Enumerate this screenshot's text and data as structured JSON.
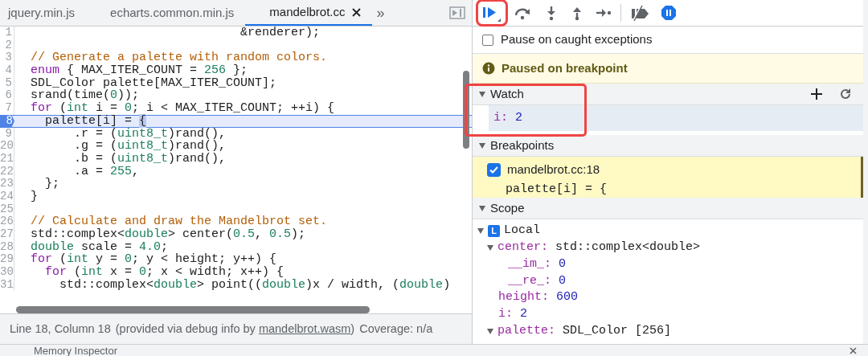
{
  "editor_tabs": [
    {
      "label": "jquery.min.js",
      "selected": false,
      "closable": false
    },
    {
      "label": "echarts.common.min.js",
      "selected": false,
      "closable": false
    },
    {
      "label": "mandelbrot.cc",
      "selected": true,
      "closable": true
    }
  ],
  "tab_overflow": "»",
  "code_lines": [
    {
      "number": "1",
      "breakpoint": false,
      "paused": false,
      "tokens": [
        {
          "text": "                               &renderer);",
          "kind": "plain"
        }
      ]
    },
    {
      "number": "2",
      "breakpoint": false,
      "paused": false
    },
    {
      "number": "3",
      "breakpoint": false,
      "paused": false,
      "tokens": [
        {
          "text": "  // Generate a palette with random colors.",
          "kind": "comment"
        }
      ]
    },
    {
      "number": "4",
      "breakpoint": false,
      "paused": false,
      "tokens": [
        {
          "text": "  enum",
          "kind": "keyword"
        },
        {
          "text": " { MAX_ITER_COUNT = ",
          "kind": "plain"
        },
        {
          "text": "256",
          "kind": "number"
        },
        {
          "text": " };",
          "kind": "plain"
        }
      ]
    },
    {
      "number": "5",
      "breakpoint": false,
      "paused": false,
      "tokens": [
        {
          "text": "  SDL_Color palette[MAX_ITER_COUNT];",
          "kind": "plain"
        }
      ]
    },
    {
      "number": "6",
      "breakpoint": false,
      "paused": false,
      "tokens": [
        {
          "text": "  srand(time(",
          "kind": "plain"
        },
        {
          "text": "0",
          "kind": "number"
        },
        {
          "text": "));",
          "kind": "plain"
        }
      ]
    },
    {
      "number": "7",
      "breakpoint": false,
      "paused": false,
      "tokens": [
        {
          "text": "  for",
          "kind": "keyword"
        },
        {
          "text": " (",
          "kind": "plain"
        },
        {
          "text": "int",
          "kind": "type"
        },
        {
          "text": " i = ",
          "kind": "plain"
        },
        {
          "text": "0",
          "kind": "number"
        },
        {
          "text": "; i < MAX_ITER_COUNT; ++i) {",
          "kind": "plain"
        }
      ]
    },
    {
      "number": "8",
      "breakpoint": true,
      "paused": true,
      "tokens": [
        {
          "text": "    palette[i] = ",
          "kind": "plain"
        },
        {
          "text": "{",
          "kind": "exec"
        }
      ]
    },
    {
      "number": "9",
      "breakpoint": false,
      "paused": false,
      "tokens": [
        {
          "text": "        .r = (",
          "kind": "plain"
        },
        {
          "text": "uint8_t",
          "kind": "type"
        },
        {
          "text": ")rand(),",
          "kind": "plain"
        }
      ]
    },
    {
      "number": "20",
      "breakpoint": false,
      "paused": false,
      "tokens": [
        {
          "text": "        .g = (",
          "kind": "plain"
        },
        {
          "text": "uint8_t",
          "kind": "type"
        },
        {
          "text": ")rand(),",
          "kind": "plain"
        }
      ]
    },
    {
      "number": "21",
      "breakpoint": false,
      "paused": false,
      "tokens": [
        {
          "text": "        .b = (",
          "kind": "plain"
        },
        {
          "text": "uint8_t",
          "kind": "type"
        },
        {
          "text": ")rand(),",
          "kind": "plain"
        }
      ]
    },
    {
      "number": "22",
      "breakpoint": false,
      "paused": false,
      "tokens": [
        {
          "text": "        .a = ",
          "kind": "plain"
        },
        {
          "text": "255",
          "kind": "number"
        },
        {
          "text": ",",
          "kind": "plain"
        }
      ]
    },
    {
      "number": "23",
      "breakpoint": false,
      "paused": false,
      "tokens": [
        {
          "text": "    };",
          "kind": "plain"
        }
      ]
    },
    {
      "number": "24",
      "breakpoint": false,
      "paused": false,
      "tokens": [
        {
          "text": "  }",
          "kind": "plain"
        }
      ]
    },
    {
      "number": "25",
      "breakpoint": false,
      "paused": false
    },
    {
      "number": "26",
      "breakpoint": false,
      "paused": false,
      "tokens": [
        {
          "text": "  // Calculate and draw the Mandelbrot set.",
          "kind": "comment"
        }
      ]
    },
    {
      "number": "27",
      "breakpoint": false,
      "paused": false,
      "tokens": [
        {
          "text": "  std::complex<",
          "kind": "plain"
        },
        {
          "text": "double",
          "kind": "type"
        },
        {
          "text": "> center(",
          "kind": "plain"
        },
        {
          "text": "0.5",
          "kind": "number"
        },
        {
          "text": ", ",
          "kind": "plain"
        },
        {
          "text": "0.5",
          "kind": "number"
        },
        {
          "text": ");",
          "kind": "plain"
        }
      ]
    },
    {
      "number": "28",
      "breakpoint": false,
      "paused": false,
      "tokens": [
        {
          "text": "  double",
          "kind": "type"
        },
        {
          "text": " scale = ",
          "kind": "plain"
        },
        {
          "text": "4.0",
          "kind": "number"
        },
        {
          "text": ";",
          "kind": "plain"
        }
      ]
    },
    {
      "number": "29",
      "breakpoint": false,
      "paused": false,
      "tokens": [
        {
          "text": "  for",
          "kind": "keyword"
        },
        {
          "text": " (",
          "kind": "plain"
        },
        {
          "text": "int",
          "kind": "type"
        },
        {
          "text": " y = ",
          "kind": "plain"
        },
        {
          "text": "0",
          "kind": "number"
        },
        {
          "text": "; y < height; y++) {",
          "kind": "plain"
        }
      ]
    },
    {
      "number": "30",
      "breakpoint": false,
      "paused": false,
      "tokens": [
        {
          "text": "    for",
          "kind": "keyword"
        },
        {
          "text": " (",
          "kind": "plain"
        },
        {
          "text": "int",
          "kind": "type"
        },
        {
          "text": " x = ",
          "kind": "plain"
        },
        {
          "text": "0",
          "kind": "number"
        },
        {
          "text": "; x < width; x++) {",
          "kind": "plain"
        }
      ]
    },
    {
      "number": "31",
      "breakpoint": false,
      "paused": false,
      "tokens": [
        {
          "text": "      std::complex<",
          "kind": "plain"
        },
        {
          "text": "double",
          "kind": "type"
        },
        {
          "text": "> point((",
          "kind": "plain"
        },
        {
          "text": "double",
          "kind": "type"
        },
        {
          "text": ")x / width, (",
          "kind": "plain"
        },
        {
          "text": "double",
          "kind": "type"
        },
        {
          "text": ")",
          "kind": "plain"
        }
      ]
    }
  ],
  "status_bar": {
    "position": "Line 18, Column 18",
    "source_prefix": "(provided via debug info by ",
    "source_link": "mandelbrot.wasm",
    "source_suffix": ")",
    "coverage": "Coverage: n/a"
  },
  "drawer": {
    "tab": "Memory Inspector"
  },
  "debugger_toolbar": [
    {
      "kind": "resume",
      "highlighted": true
    },
    {
      "kind": "step-over",
      "highlighted": false
    },
    {
      "kind": "step-into",
      "highlighted": false
    },
    {
      "kind": "step-out",
      "highlighted": false
    },
    {
      "kind": "step",
      "highlighted": false
    },
    {
      "kind": "separator"
    },
    {
      "kind": "deactivate",
      "highlighted": false
    },
    {
      "kind": "pause-exceptions",
      "highlighted": false
    }
  ],
  "pause_on_caught": {
    "label": "Pause on caught exceptions",
    "checked": false
  },
  "paused_message": "Paused on breakpoint",
  "watch": {
    "title": "Watch",
    "expanded": true,
    "highlighted": true,
    "items": [
      {
        "name": "i:",
        "value": "2"
      }
    ]
  },
  "breakpoints": {
    "title": "Breakpoints",
    "expanded": true,
    "items": [
      {
        "location": "mandelbrot.cc:18",
        "code": "palette[i] = {",
        "checked": true
      }
    ]
  },
  "scope": {
    "title": "Scope",
    "expanded": true,
    "items": [
      {
        "kind": "scope",
        "name": "Local",
        "badge": "L",
        "expanded": true,
        "children": [
          {
            "kind": "object",
            "name": "center:",
            "value": "std::complex<double>",
            "expanded": true,
            "children": [
              {
                "kind": "number",
                "name": "__im_:",
                "value": "0"
              },
              {
                "kind": "number",
                "name": "__re_:",
                "value": "0"
              }
            ]
          },
          {
            "kind": "number",
            "name": "height:",
            "value": "600"
          },
          {
            "kind": "number",
            "name": "i:",
            "value": "2"
          },
          {
            "kind": "object",
            "name": "palette:",
            "value": "SDL_Color [256]",
            "expanded": true
          }
        ]
      }
    ]
  }
}
